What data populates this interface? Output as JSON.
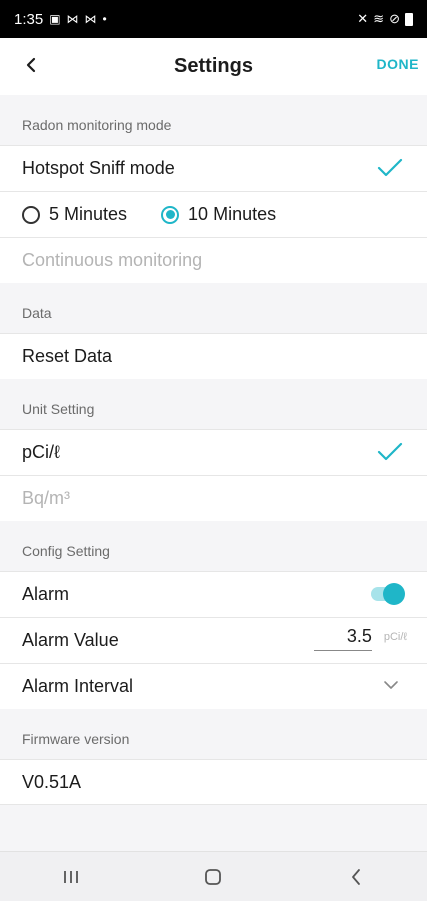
{
  "status_bar": {
    "time": "1:35"
  },
  "header": {
    "title": "Settings",
    "done_label": "DONE"
  },
  "radon": {
    "section_label": "Radon monitoring mode",
    "hotspot_label": "Hotspot Sniff mode",
    "options": [
      "5 Minutes",
      "10 Minutes"
    ],
    "selected_option": "10 Minutes",
    "continuous_label": "Continuous monitoring"
  },
  "data_section": {
    "section_label": "Data",
    "reset_label": "Reset Data"
  },
  "unit_section": {
    "section_label": "Unit Setting",
    "units": [
      "pCi/ℓ",
      "Bq/m³"
    ],
    "selected_unit": "pCi/ℓ"
  },
  "config": {
    "section_label": "Config Setting",
    "alarm_label": "Alarm",
    "alarm_enabled": true,
    "alarm_value_label": "Alarm Value",
    "alarm_value": "3.5",
    "alarm_unit": "pCi/ℓ",
    "alarm_interval_label": "Alarm Interval"
  },
  "firmware": {
    "section_label": "Firmware version",
    "version": "V0.51A"
  },
  "colors": {
    "accent": "#1fb6c8",
    "background": "#f5f5f7"
  }
}
